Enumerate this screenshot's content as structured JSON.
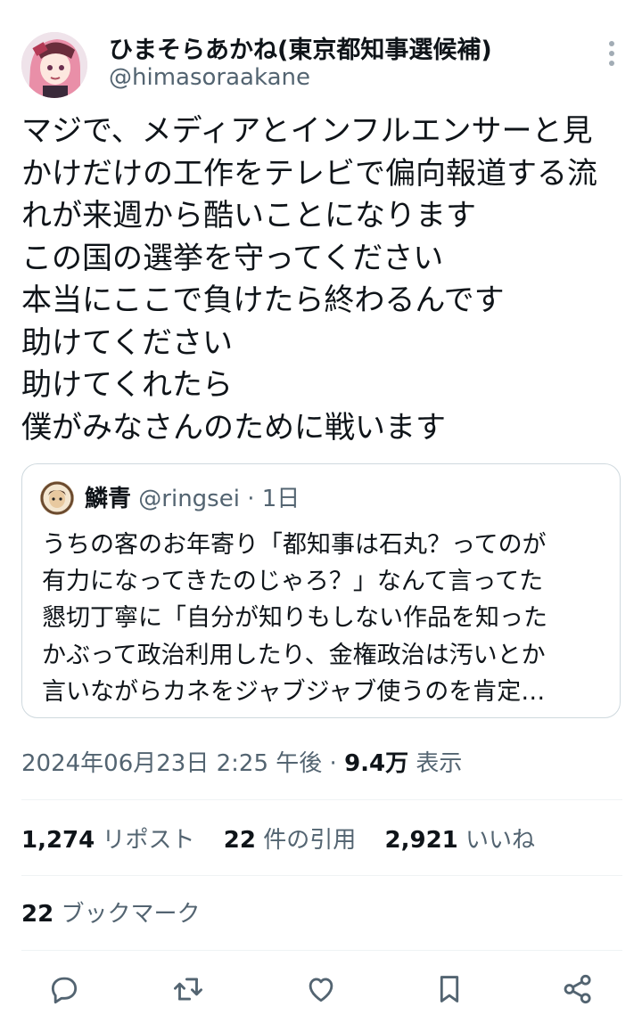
{
  "author": {
    "name": "ひまそらあかね(東京都知事選候補)",
    "handle": "@himasoraakane"
  },
  "tweet_lines": [
    "マジで、メディアとインフルエンサーと見",
    "かけだけの工作をテレビで偏向報道する流",
    "れが来週から酷いことになります",
    "この国の選挙を守ってください",
    "本当にここで負けたら終わるんです",
    "助けてください",
    "助けてくれたら",
    "僕がみなさんのために戦います"
  ],
  "quote": {
    "name": "鱗青",
    "handle": "@ringsei",
    "sep": "·",
    "time": "1日",
    "lines": [
      "うちの客のお年寄り「都知事は石丸？ってのが",
      "有力になってきたのじゃろ？」なんて言ってた",
      "懇切丁寧に「自分が知りもしない作品を知った",
      "かぶって政治利用したり、金権政治は汚いとか",
      "言いながらカネをジャブジャブ使うのを肯定…"
    ]
  },
  "meta": {
    "datetime": "2024年06月23日 2:25 午後",
    "sep": "·",
    "views": "9.4万",
    "views_label": "表示"
  },
  "stats": {
    "reposts": "1,274",
    "reposts_label": "リポスト",
    "quotes": "22",
    "quotes_label": "件の引用",
    "likes": "2,921",
    "likes_label": "いいね",
    "bookmarks": "22",
    "bookmarks_label": "ブックマーク"
  },
  "actions": [
    "reply-icon",
    "repost-icon",
    "like-icon",
    "bookmark-icon",
    "share-icon"
  ],
  "colors": {
    "text": "#0f1419",
    "secondary": "#536471",
    "border": "#cfd9de",
    "icon": "#536471"
  }
}
